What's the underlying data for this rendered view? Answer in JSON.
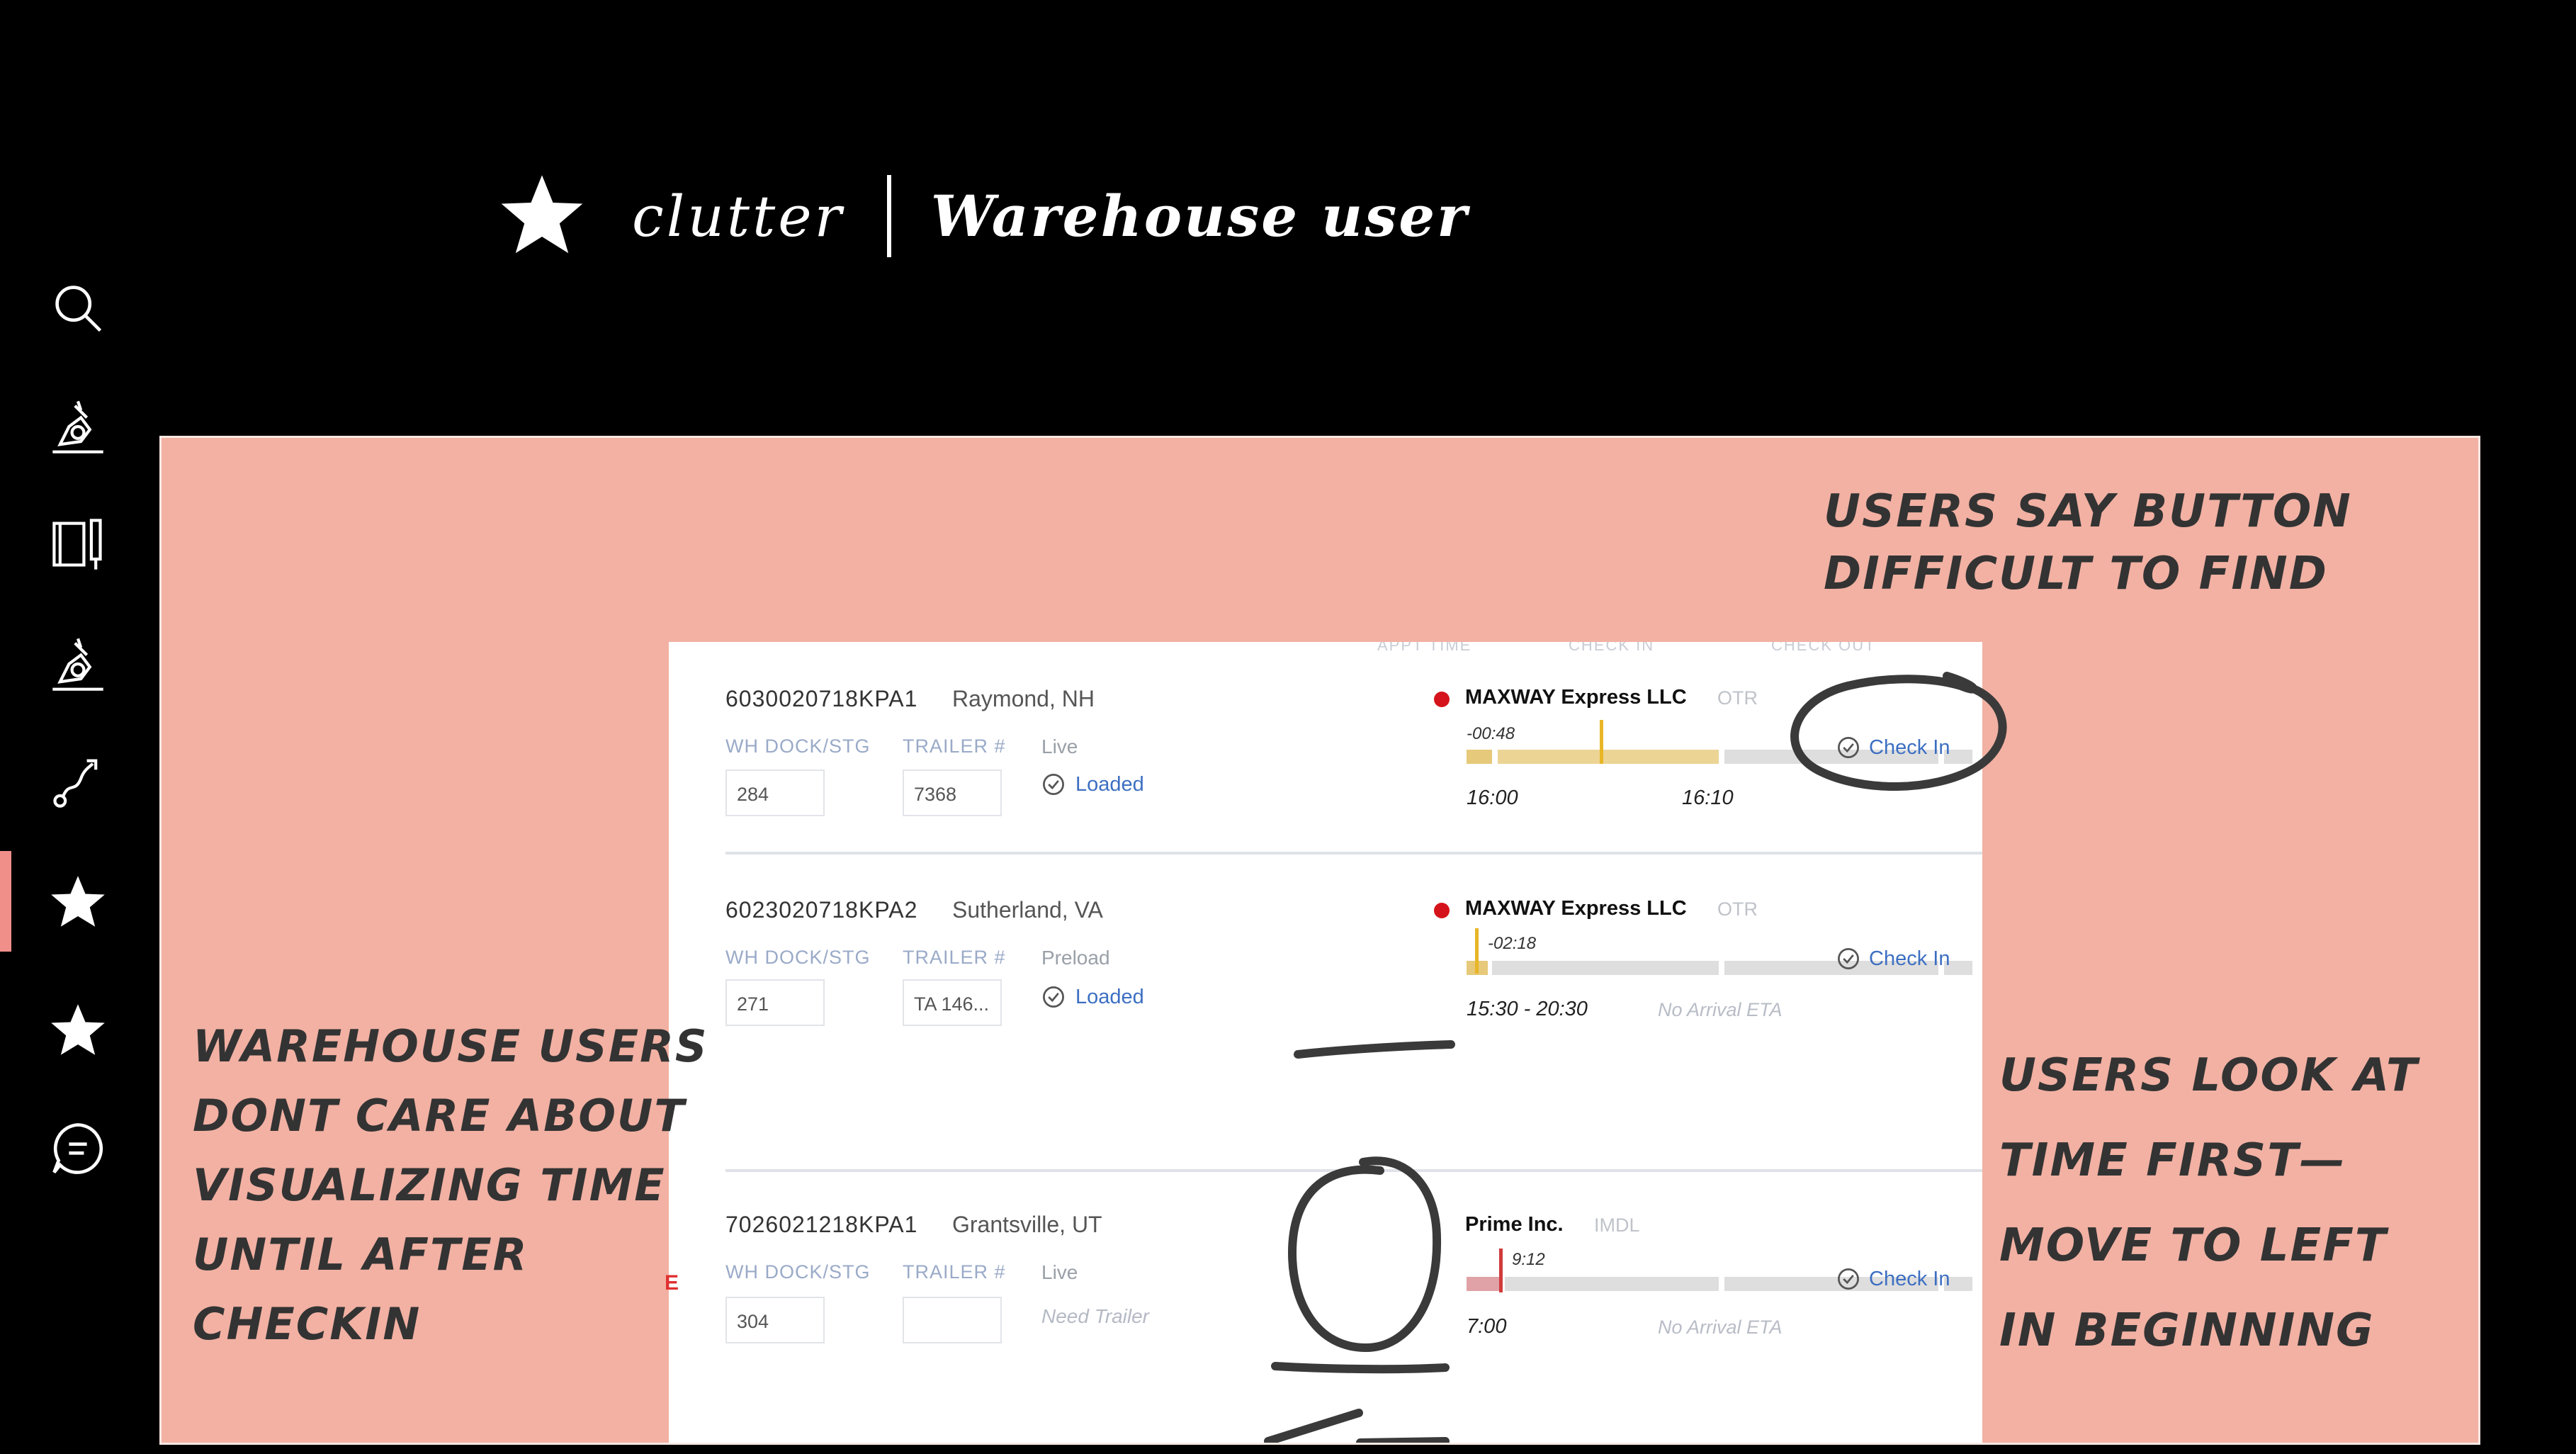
{
  "header": {
    "app_name": "clutter",
    "page_title": "Warehouse user"
  },
  "rail": {
    "items": [
      {
        "icon": "search-icon"
      },
      {
        "icon": "microscope-icon"
      },
      {
        "icon": "notebook-icon"
      },
      {
        "icon": "microscope-icon"
      },
      {
        "icon": "route-icon"
      },
      {
        "icon": "star-icon",
        "active": true
      },
      {
        "icon": "star-icon"
      },
      {
        "icon": "chat-icon"
      }
    ],
    "active_color": "#f08f8a"
  },
  "slide": {
    "background": "#f2b1a3",
    "columns": {
      "appt_time": "APPT TIME",
      "check_in": "CHECK IN",
      "check_out": "CHECK OUT"
    },
    "rows": [
      {
        "load_id": "6030020718KPA1",
        "location": "Raymond, NH",
        "dock_label": "WH DOCK/STG",
        "dock_value": "284",
        "trailer_label": "TRAILER #",
        "trailer_value": "7368",
        "status": "Live",
        "loaded_label": "Loaded",
        "carrier": "MAXWAY Express LLC",
        "mode": "OTR",
        "offset": "-00:48",
        "appt_time": "16:00",
        "arrival": "16:10",
        "checkin_label": "Check In"
      },
      {
        "load_id": "6023020718KPA2",
        "location": "Sutherland, VA",
        "dock_label": "WH DOCK/STG",
        "dock_value": "271",
        "trailer_label": "TRAILER #",
        "trailer_value": "TA 146...",
        "status": "Preload",
        "loaded_label": "Loaded",
        "carrier": "MAXWAY Express LLC",
        "mode": "OTR",
        "offset": "-02:18",
        "appt_time": "15:30 - 20:30",
        "eta": "No Arrival ETA",
        "checkin_label": "Check In"
      },
      {
        "load_id": "7026021218KPA1",
        "location": "Grantsville, UT",
        "dock_label": "WH DOCK/STG",
        "dock_value": "304",
        "trailer_label": "TRAILER #",
        "trailer_value": "",
        "status": "Live",
        "need_trailer": "Need Trailer",
        "carrier": "Prime Inc.",
        "mode": "IMDL",
        "offset": "9:12",
        "appt_time": "7:00",
        "eta": "No Arrival ETA",
        "checkin_label": "Check In"
      }
    ],
    "edge_letter": "E",
    "notes": {
      "button": [
        "USERS SAY BUTTON",
        "DIFFICULT TO FIND"
      ],
      "time": [
        "USERS LOOK AT",
        "TIME FIRST—",
        "MOVE TO LEFT",
        "IN BEGINNING"
      ],
      "visualize": [
        "WAREHOUSE USERS",
        "DONT CARE ABOUT",
        "VISUALIZING TIME",
        "UNTIL AFTER",
        "CHECKIN"
      ]
    }
  }
}
